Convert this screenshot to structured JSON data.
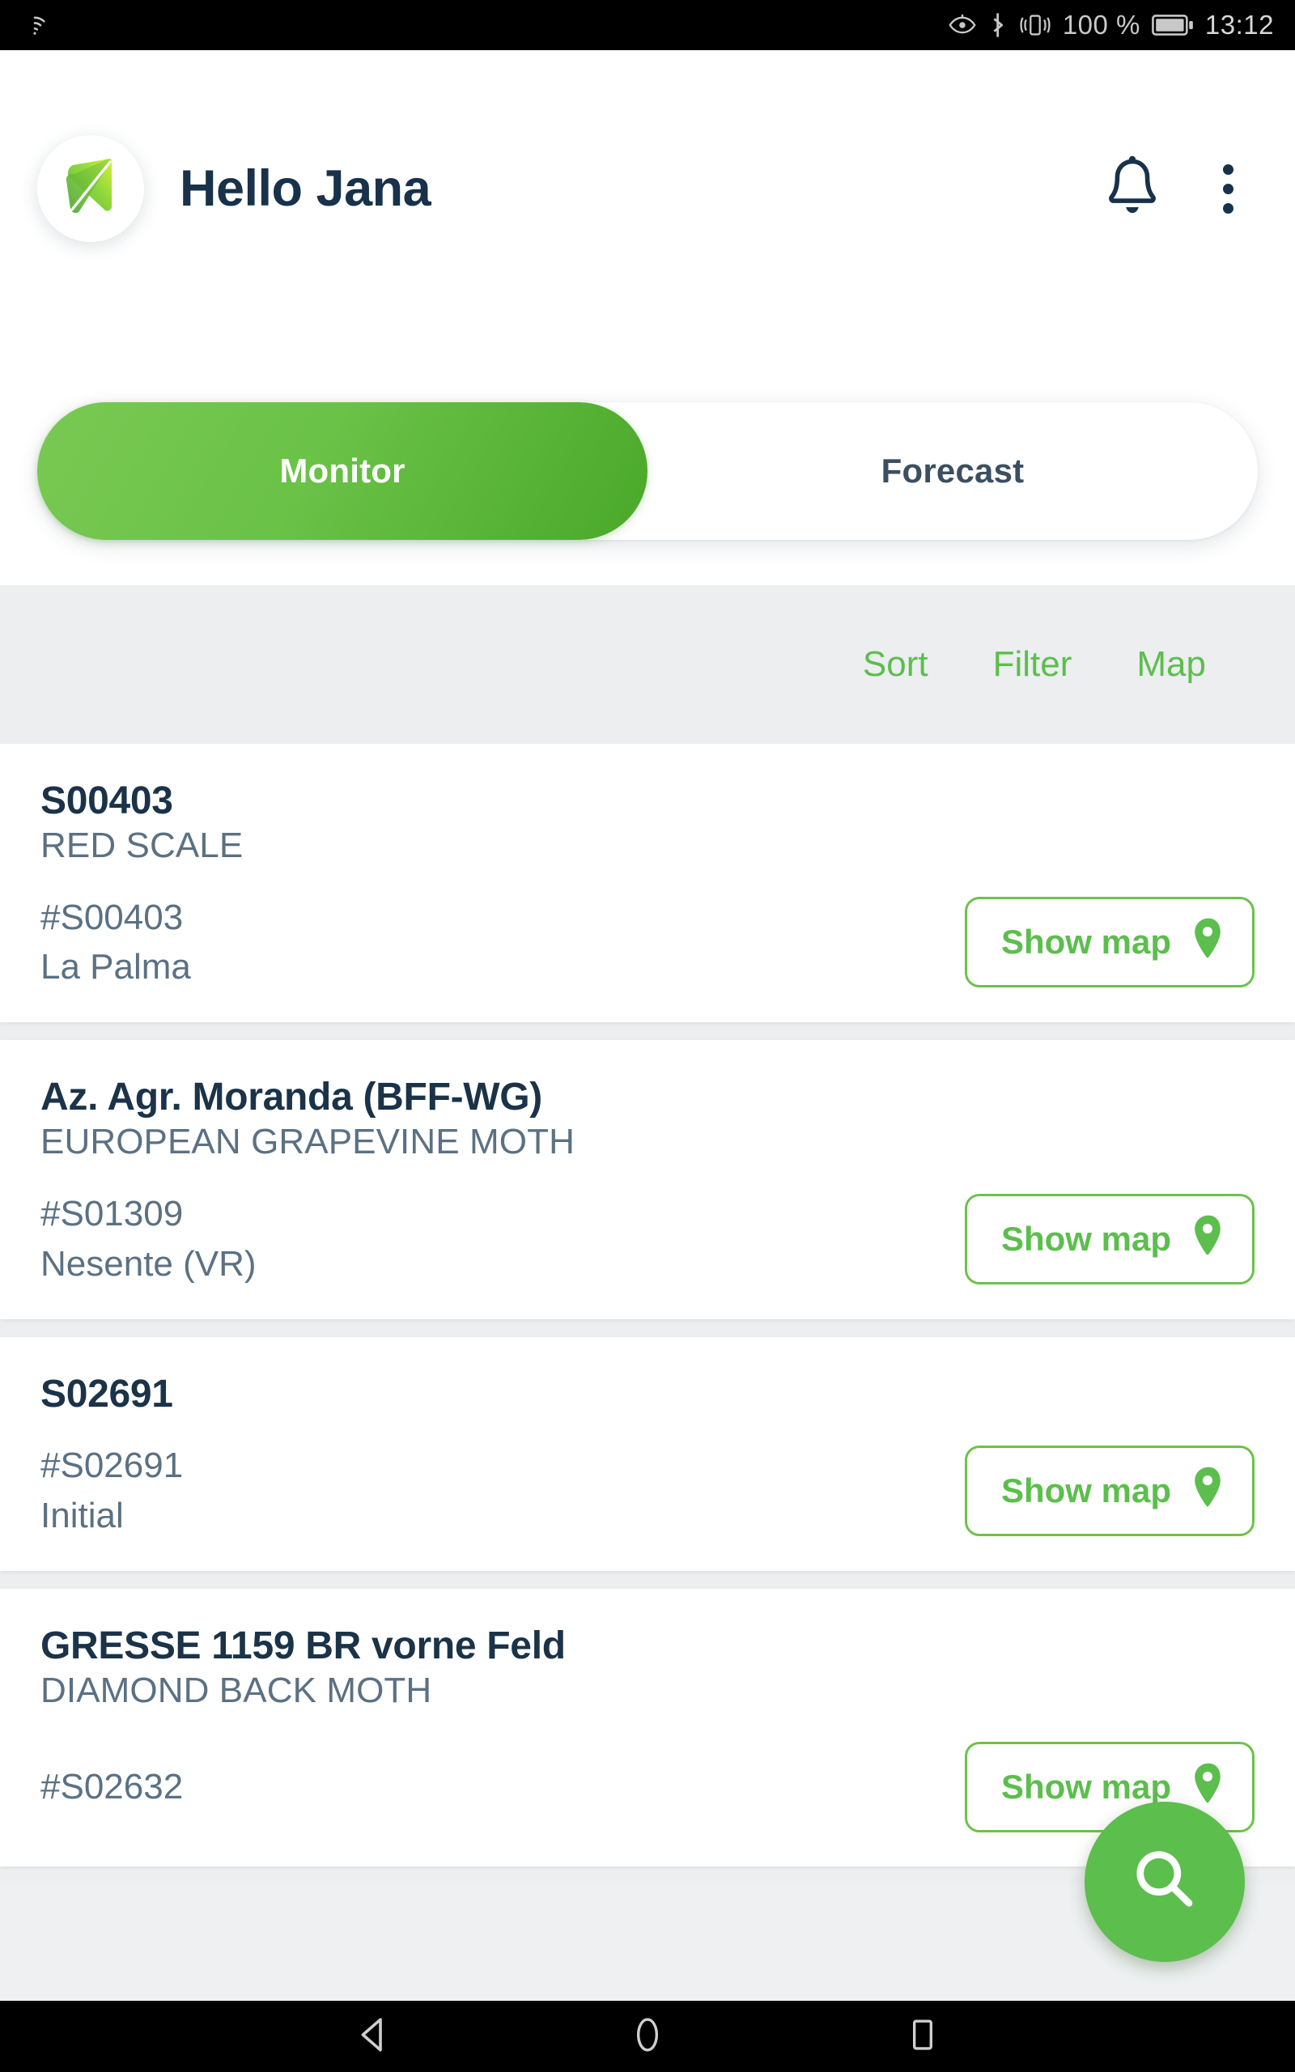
{
  "statusbar": {
    "wifi_icon": "wifi-icon",
    "eye_icon": "eye-comfort-icon",
    "bluetooth_icon": "bluetooth-icon",
    "vibrate_icon": "vibrate-icon",
    "battery_percent": "100 %",
    "battery_icon": "battery-full-icon",
    "time": "13:12"
  },
  "header": {
    "logo_icon": "leaf-logo-icon",
    "greeting": "Hello Jana",
    "bell_icon": "bell-icon",
    "overflow_icon": "more-vertical-icon"
  },
  "tabs": [
    {
      "label": "Monitor",
      "active": true
    },
    {
      "label": "Forecast",
      "active": false
    }
  ],
  "actionbar": {
    "sort": "Sort",
    "filter": "Filter",
    "map": "Map"
  },
  "cards": [
    {
      "title": "S00403",
      "subtitle": "RED SCALE",
      "id": "#S00403",
      "location": "La Palma",
      "button": "Show map",
      "pin_icon": "map-pin-icon"
    },
    {
      "title": "Az. Agr. Moranda (BFF-WG)",
      "subtitle": "EUROPEAN GRAPEVINE MOTH",
      "id": "#S01309",
      "location": "Nesente (VR)",
      "button": "Show map",
      "pin_icon": "map-pin-icon"
    },
    {
      "title": "S02691",
      "subtitle": "",
      "id": "#S02691",
      "location": "Initial",
      "button": "Show map",
      "pin_icon": "map-pin-icon"
    },
    {
      "title": "GRESSE 1159 BR vorne Feld",
      "subtitle": "DIAMOND BACK MOTH",
      "id": "#S02632",
      "location": "",
      "button": "Show map",
      "pin_icon": "map-pin-icon"
    }
  ],
  "fab": {
    "icon": "search-icon"
  },
  "navbar": {
    "back_icon": "back-triangle-icon",
    "home_icon": "home-circle-icon",
    "recents_icon": "recents-square-icon"
  },
  "colors": {
    "accent_green": "#5cbe4d",
    "accent_green_dark": "#4aa829",
    "title_navy": "#1b3348",
    "muted_slate": "#5b7183",
    "bar_gray": "#eceef0"
  }
}
